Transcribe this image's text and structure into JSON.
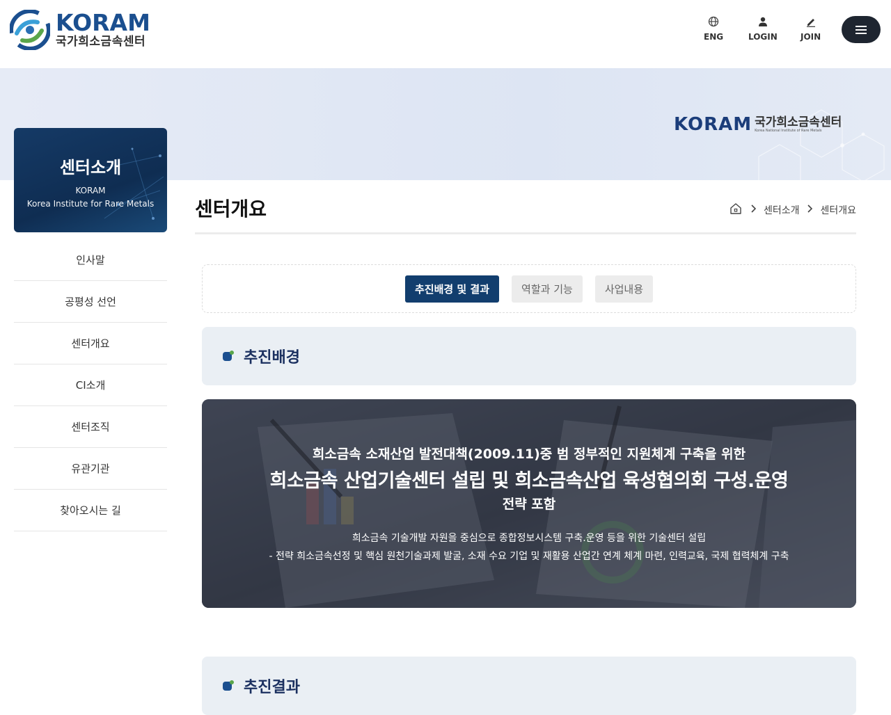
{
  "header": {
    "logo_en": "KORAM",
    "logo_ko": "국가희소금속센터",
    "utils": [
      {
        "label": "ENG",
        "icon": "globe-icon"
      },
      {
        "label": "LOGIN",
        "icon": "user-icon"
      },
      {
        "label": "JOIN",
        "icon": "pencil-icon"
      }
    ],
    "menu_icon": "hamburger-icon"
  },
  "visual": {
    "logo_en": "KORAM",
    "logo_ko": "국가희소금속센터",
    "logo_sub": "Korea National Institute of Rare Metals"
  },
  "sidebar": {
    "title": "센터소개",
    "subtitle_1": "KORAM",
    "subtitle_2": "Korea Institute for Rare Metals",
    "items": [
      "인사말",
      "공평성 선언",
      "센터개요",
      "CI소개",
      "센터조직",
      "유관기관",
      "찾아오시는 길"
    ]
  },
  "page": {
    "title": "센터개요",
    "breadcrumb": [
      "센터소개",
      "센터개요"
    ]
  },
  "tabs": [
    {
      "label": "추진배경 및 결과",
      "active": true
    },
    {
      "label": "역할과 기능",
      "active": false
    },
    {
      "label": "사업내용",
      "active": false
    }
  ],
  "sections": {
    "background_title": "추진배경",
    "result_title": "추진결과"
  },
  "hero": {
    "line1": "희소금속 소재산업 발전대책(2009.11)중 범 정부적인 지원체계 구축을 위한",
    "line2": "희소금속 산업기술센터 설립 및 희소금속산업 육성협의회 구성.운영",
    "line3": "전략 포함",
    "line4": "희소금속 기술개발 자원을 중심으로 종합정보시스템 구축.운영 등을 위한 기술센터 설립",
    "line5": "- 전략 희소금속선정 및 핵심 원천기술과제 발굴, 소재 수요 기업 및 재활용 산업간 연계 체계 마련, 인력교육, 국제 협력체계 구축"
  },
  "colors": {
    "brand_navy": "#123e6e",
    "brand_blue": "#1b4f8f",
    "brand_green": "#5aa64a"
  }
}
